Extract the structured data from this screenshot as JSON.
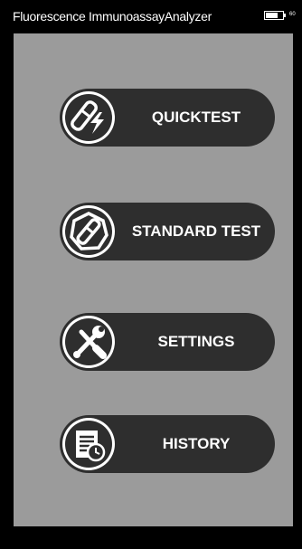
{
  "status_bar": {
    "title": "Fluorescence ImmunoassayAnalyzer",
    "battery_level": 0.7,
    "battery_text": "60"
  },
  "menu": {
    "items": [
      {
        "id": "quick",
        "label": "QUICKTEST",
        "icon": "test-strip-lightning-icon"
      },
      {
        "id": "standard",
        "label": "STANDARD TEST",
        "icon": "test-strip-hexagon-icon"
      },
      {
        "id": "settings",
        "label": "SETTINGS",
        "icon": "wrench-screwdriver-icon"
      },
      {
        "id": "history",
        "label": "HISTORY",
        "icon": "document-clock-icon"
      }
    ]
  },
  "colors": {
    "background": "#000000",
    "panel": "#9b9b9b",
    "button": "#2e2e2e",
    "text": "#ffffff"
  }
}
